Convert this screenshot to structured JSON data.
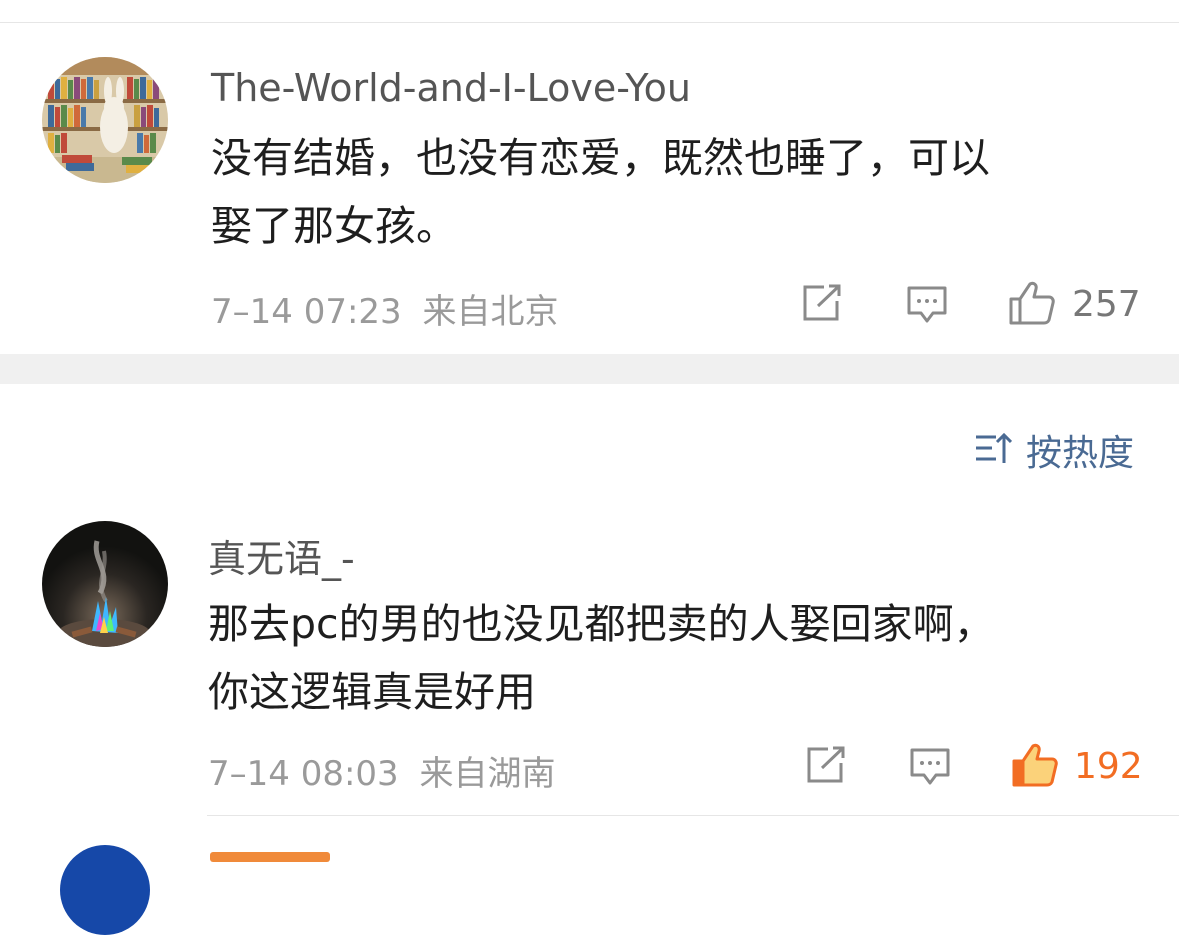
{
  "comments": [
    {
      "username": "The-World-and-I-Love-You",
      "content_lines": [
        "没有结婚，也没有恋爱，既然也睡了，可以",
        "娶了那女孩。"
      ],
      "time": "7–14 07:23",
      "location": "来自北京",
      "like_count": "257",
      "liked": false,
      "avatar": "bookshelf-rabbit-illustration"
    },
    {
      "username": "真无语_-",
      "content_lines": [
        "那去pc的男的也没见都把卖的人娶回家啊，",
        "你这逻辑真是好用"
      ],
      "time": "7–14 08:03",
      "location": "来自湖南",
      "like_count": "192",
      "liked": true,
      "avatar": "night-bonfire-photo"
    }
  ],
  "sort": {
    "label": "按热度",
    "icon": "sort-icon"
  },
  "icons": {
    "share": "share-icon",
    "comment": "comment-icon",
    "like": "thumbs-up-icon"
  },
  "colors": {
    "like_active": "#f26d23",
    "sort_label": "#4a6a93",
    "meta_gray": "#9a9a9a",
    "section_gap": "#f0f0f0"
  }
}
